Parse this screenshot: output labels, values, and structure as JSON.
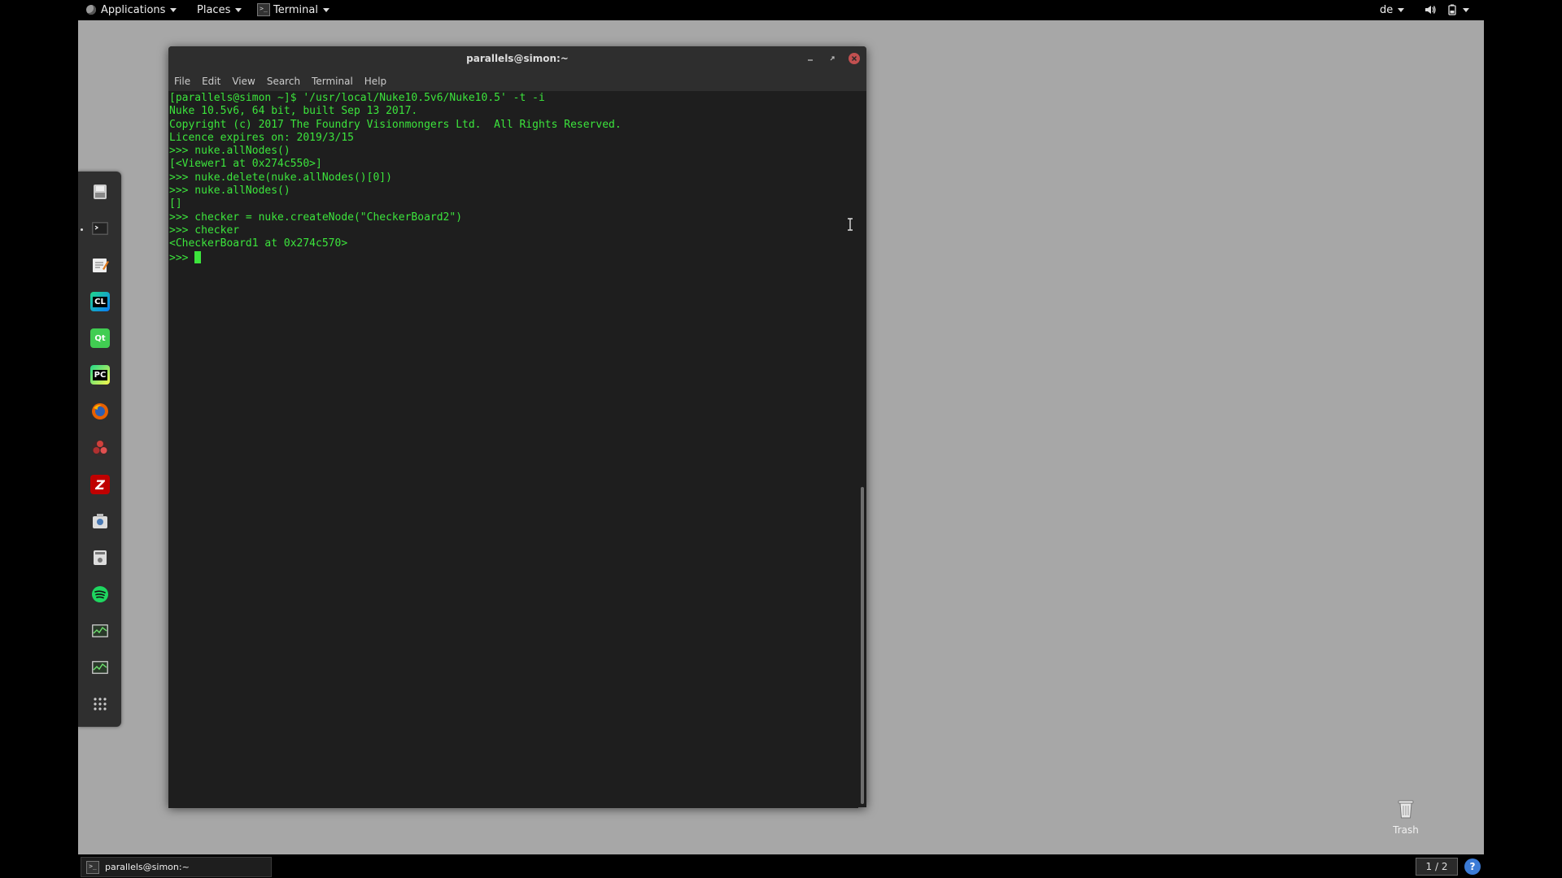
{
  "topbar": {
    "applications": "Applications",
    "places": "Places",
    "terminal": "Terminal",
    "language": "de"
  },
  "window": {
    "title": "parallels@simon:~",
    "menu": [
      "File",
      "Edit",
      "View",
      "Search",
      "Terminal",
      "Help"
    ]
  },
  "terminal": {
    "lines": [
      "[parallels@simon ~]$ '/usr/local/Nuke10.5v6/Nuke10.5' -t -i",
      "Nuke 10.5v6, 64 bit, built Sep 13 2017.",
      "Copyright (c) 2017 The Foundry Visionmongers Ltd.  All Rights Reserved.",
      "Licence expires on: 2019/3/15",
      ">>> nuke.allNodes()",
      "[<Viewer1 at 0x274c550>]",
      ">>> nuke.delete(nuke.allNodes()[0])",
      ">>> nuke.allNodes()",
      "[]",
      ">>> checker = nuke.createNode(\"CheckerBoard2\")",
      ">>> checker",
      "<CheckerBoard1 at 0x274c570>"
    ],
    "prompt": ">>> ",
    "text_color": "#3ce43c"
  },
  "dock": {
    "items": [
      {
        "name": "files",
        "icon": "file-manager-icon"
      },
      {
        "name": "terminal",
        "icon": "terminal-icon",
        "running": true
      },
      {
        "name": "text-editor",
        "icon": "text-editor-icon"
      },
      {
        "name": "clion",
        "icon": "clion-icon",
        "label": "CL"
      },
      {
        "name": "qt-creator",
        "icon": "qt-creator-icon",
        "label": "Qt"
      },
      {
        "name": "pycharm",
        "icon": "pycharm-icon",
        "label": "PC"
      },
      {
        "name": "firefox",
        "icon": "firefox-icon"
      },
      {
        "name": "davinci",
        "icon": "davinci-resolve-icon"
      },
      {
        "name": "filezilla",
        "icon": "filezilla-icon",
        "label": "Z"
      },
      {
        "name": "screenshot",
        "icon": "screenshot-icon"
      },
      {
        "name": "disks",
        "icon": "disks-icon"
      },
      {
        "name": "spotify",
        "icon": "spotify-icon"
      },
      {
        "name": "system-monitor",
        "icon": "system-monitor-icon"
      },
      {
        "name": "system-monitor-2",
        "icon": "system-monitor-icon"
      },
      {
        "name": "show-apps",
        "icon": "app-grid-icon"
      }
    ]
  },
  "desktop": {
    "trash_label": "Trash"
  },
  "bottombar": {
    "task_label": "parallels@simon:~",
    "workspace": "1 / 2",
    "help": "?"
  }
}
